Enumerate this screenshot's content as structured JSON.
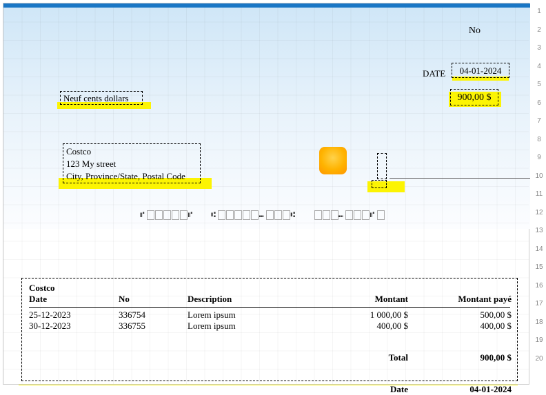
{
  "rownums": [
    "1",
    "2",
    "3",
    "4",
    "5",
    "6",
    "7",
    "8",
    "9",
    "10",
    "11",
    "12",
    "13",
    "14",
    "15",
    "16",
    "17",
    "18",
    "19",
    "20"
  ],
  "cheque": {
    "no_label": "No",
    "date_label": "DATE",
    "date_value": "04-01-2024",
    "amount_words": "Neuf cents dollars",
    "amount_numeric": "900,00 $",
    "payee_name": "Costco",
    "payee_addr1": "123 My street",
    "payee_addr2": "City, Province/State, Postal Code"
  },
  "micr": {
    "g1_prefix": "⑈",
    "g1_suffix": "⑈",
    "g2_prefix": "⑆",
    "g2_mid": "⑉",
    "g2_suffix": "⑆",
    "g3_mid": "⑉",
    "g3_suffix": "⑈"
  },
  "stub": {
    "payee": "Costco",
    "cols": {
      "date": "Date",
      "no": "No",
      "desc": "Description",
      "amount": "Montant",
      "paid": "Montant payé"
    },
    "rows": [
      {
        "date": "25-12-2023",
        "no": "336754",
        "desc": "Lorem ipsum",
        "amount": "1 000,00 $",
        "paid": "500,00 $"
      },
      {
        "date": "30-12-2023",
        "no": "336755",
        "desc": "Lorem ipsum",
        "amount": "400,00 $",
        "paid": "400,00 $"
      }
    ],
    "total_label": "Total",
    "total_value": "900,00 $",
    "date_label": "Date",
    "date_value": "04-01-2024"
  }
}
